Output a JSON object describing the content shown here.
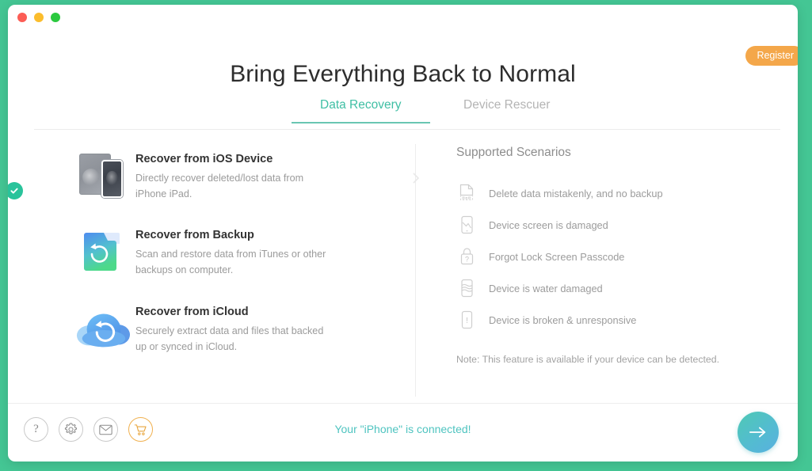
{
  "window": {
    "traffic_lights": [
      {
        "name": "close",
        "color": "#fc5d55"
      },
      {
        "name": "minimize",
        "color": "#fbbd2d"
      },
      {
        "name": "zoom",
        "color": "#2bc93f"
      }
    ],
    "background_color": "#44c694"
  },
  "header": {
    "title": "Bring Everything Back to Normal",
    "register_label": "Register",
    "register_color": "#f4a74a"
  },
  "tabs": [
    {
      "label": "Data Recovery",
      "active": true,
      "accent": "#3fbfa4"
    },
    {
      "label": "Device Rescuer",
      "active": false,
      "accent": "#b4b4b4"
    }
  ],
  "options": [
    {
      "title": "Recover from iOS Device",
      "description": "Directly recover deleted/lost data from iPhone iPad.",
      "icon": "ios-device-icon",
      "selected": true
    },
    {
      "title": "Recover from Backup",
      "description": "Scan and restore data from iTunes or other backups on computer.",
      "icon": "backup-folder-icon",
      "selected": false
    },
    {
      "title": "Recover from iCloud",
      "description": "Securely extract data and files that backed up or synced in iCloud.",
      "icon": "icloud-icon",
      "selected": false
    }
  ],
  "scenarios": {
    "title": "Supported Scenarios",
    "items": [
      {
        "label": "Delete data mistakenly, and no backup",
        "icon": "deleted-file-icon"
      },
      {
        "label": "Device screen is damaged",
        "icon": "cracked-screen-icon"
      },
      {
        "label": "Forgot Lock Screen Passcode",
        "icon": "lock-question-icon"
      },
      {
        "label": "Device is water damaged",
        "icon": "water-damage-icon"
      },
      {
        "label": "Device is broken & unresponsive",
        "icon": "broken-device-icon"
      }
    ],
    "note": "Note: This feature is available if your device can be detected."
  },
  "bottom": {
    "tools": [
      {
        "name": "help-icon",
        "glyph": "?"
      },
      {
        "name": "settings-icon",
        "glyph": ""
      },
      {
        "name": "feedback-icon",
        "glyph": ""
      },
      {
        "name": "cart-icon",
        "glyph": ""
      }
    ],
    "status": "Your \"iPhone\" is connected!",
    "status_color": "#4fc4c0",
    "next_label": "next"
  }
}
